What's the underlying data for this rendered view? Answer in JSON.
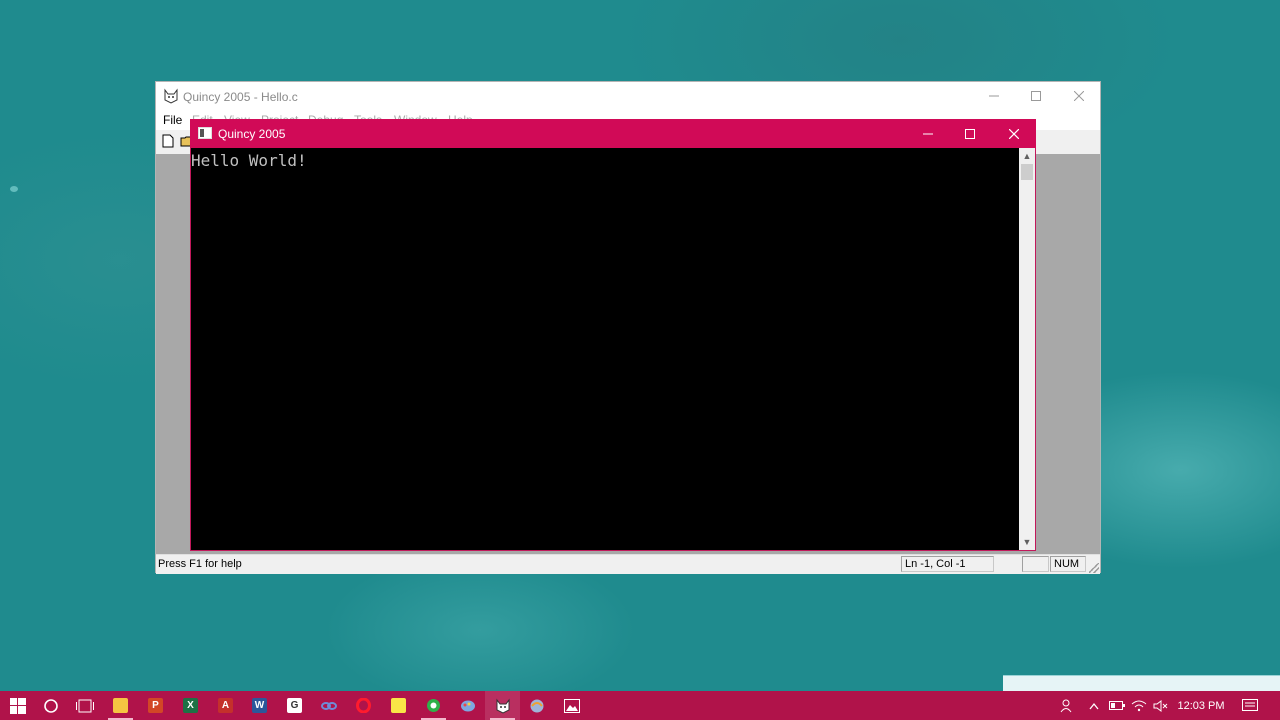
{
  "main_window": {
    "title": "Quincy 2005 - Hello.c",
    "menu": [
      "File",
      "Edit",
      "View",
      "Project",
      "Debug",
      "Tools",
      "Window",
      "Help"
    ],
    "status": {
      "help_text": "Press F1 for help",
      "position": "Ln -1, Col -1",
      "num": "NUM"
    }
  },
  "console": {
    "title": "Quincy 2005",
    "output": "Hello World!"
  },
  "taskbar": {
    "apps": [
      "start",
      "search",
      "task-view",
      "file-explorer",
      "powerpoint",
      "excel",
      "acrobat",
      "word",
      "pen-app",
      "link-app",
      "opera",
      "sticky-notes",
      "green-app",
      "paint-app",
      "quincy",
      "browser-app",
      "photos"
    ],
    "time": "12:03 PM"
  },
  "colors": {
    "console_accent": "#d10a57",
    "taskbar": "#b0134a",
    "desktop": "#1f8b8e"
  }
}
